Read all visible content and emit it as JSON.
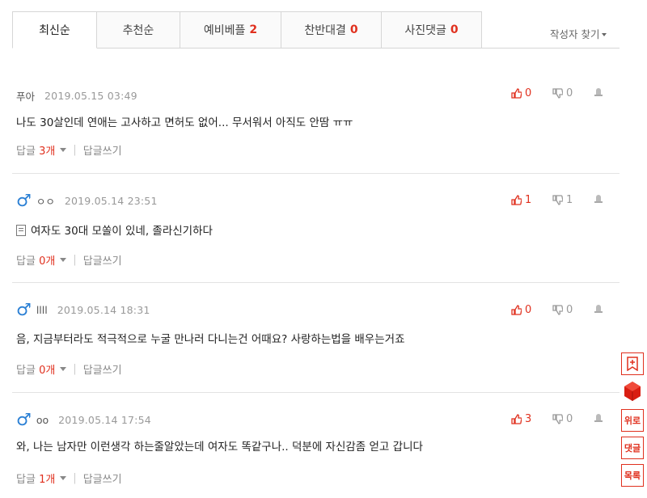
{
  "tabs": [
    {
      "label": "최신순",
      "count": ""
    },
    {
      "label": "추천순",
      "count": ""
    },
    {
      "label": "예비베플",
      "count": "2"
    },
    {
      "label": "찬반대결",
      "count": "0"
    },
    {
      "label": "사진댓글",
      "count": "0"
    }
  ],
  "find_author": "작성자 찾기",
  "comments": [
    {
      "nick": "푸아",
      "date": "2019.05.15 03:49",
      "text": "나도 30살인데 연애는 고사하고 면허도 없어... 무서워서 아직도 안땀 ㅠㅠ",
      "up": "0",
      "down": "0",
      "reply_label": "답글",
      "reply_count": "3개",
      "write_label": "답글쓰기"
    },
    {
      "nick": "ㅇㅇ",
      "date": "2019.05.14 23:51",
      "text": "여자도 30대 모쏠이 있네, 졸라신기하다",
      "up": "1",
      "down": "1",
      "reply_label": "답글",
      "reply_count": "0개",
      "write_label": "답글쓰기"
    },
    {
      "nick": "llll",
      "date": "2019.05.14 18:31",
      "text": "음, 지금부터라도 적극적으로 누굴 만나러 다니는건 어때요? 사랑하는법을 배우는거죠",
      "up": "0",
      "down": "0",
      "reply_label": "답글",
      "reply_count": "0개",
      "write_label": "답글쓰기"
    },
    {
      "nick": "oo",
      "date": "2019.05.14 17:54",
      "text": "와, 나는 남자만 이런생각 하는줄알았는데 여자도 똑같구나.. 덕분에 자신감좀 얻고 갑니다",
      "up": "3",
      "down": "0",
      "reply_label": "답글",
      "reply_count": "1개",
      "write_label": "답글쓰기"
    }
  ],
  "side": {
    "top": "위로",
    "reply": "댓글",
    "list": "목록"
  },
  "colors": {
    "accent": "#e0301e",
    "male": "#2a7fd4"
  }
}
